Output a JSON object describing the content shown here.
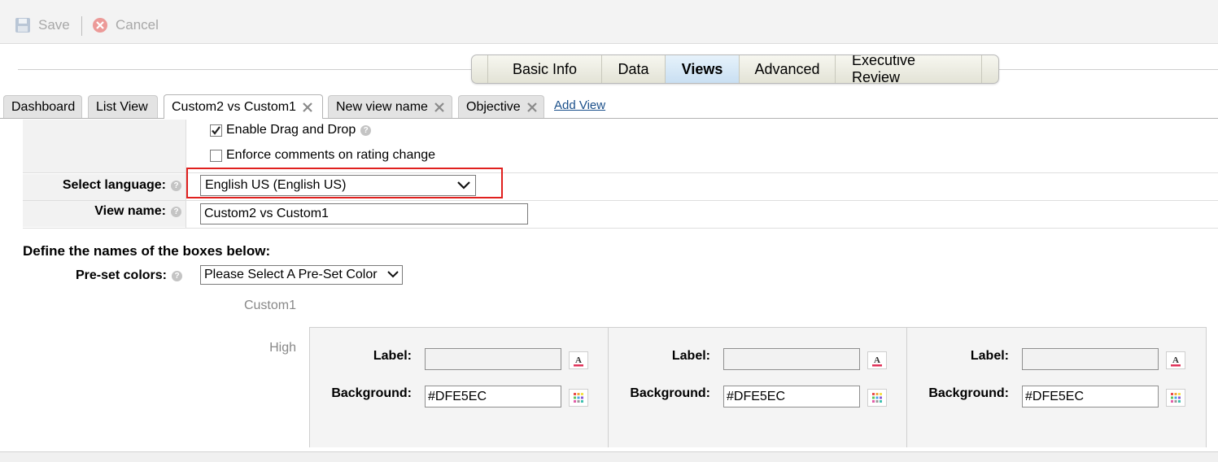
{
  "toolbar": {
    "save_label": "Save",
    "cancel_label": "Cancel"
  },
  "main_tabs": [
    {
      "label": "Basic Info",
      "active": false
    },
    {
      "label": "Data",
      "active": false
    },
    {
      "label": "Views",
      "active": true
    },
    {
      "label": "Advanced",
      "active": false
    },
    {
      "label": "Executive Review",
      "active": false
    }
  ],
  "sub_tabs": [
    {
      "label": "Dashboard",
      "closable": false
    },
    {
      "label": "List View",
      "closable": false
    },
    {
      "label": "Custom2 vs Custom1",
      "closable": true,
      "active": true
    },
    {
      "label": "New view name",
      "closable": true
    },
    {
      "label": "Objective",
      "closable": true
    }
  ],
  "add_view_label": "Add View",
  "options": {
    "drag_drop": {
      "label": "Enable Drag and Drop",
      "checked": true
    },
    "enforce_comments": {
      "label": "Enforce comments on rating change",
      "checked": false
    }
  },
  "language": {
    "label": "Select language:",
    "value": "English US (English US)"
  },
  "view_name": {
    "label": "View name:",
    "value": "Custom2 vs Custom1"
  },
  "section_title": "Define the names of the boxes below:",
  "preset": {
    "label": "Pre-set colors:",
    "value": "Please Select A Pre-Set Color"
  },
  "axis_labels": {
    "column_header": "Custom1",
    "row_header": "High"
  },
  "boxes": [
    {
      "label_caption": "Label:",
      "label_value": "",
      "background_caption": "Background:",
      "background_value": "#DFE5EC"
    },
    {
      "label_caption": "Label:",
      "label_value": "",
      "background_caption": "Background:",
      "background_value": "#DFE5EC"
    },
    {
      "label_caption": "Label:",
      "label_value": "",
      "background_caption": "Background:",
      "background_value": "#DFE5EC"
    }
  ],
  "colors": {
    "highlight": "#e0201e",
    "link": "#1a4f8a",
    "active_tab": "#c9dff2"
  }
}
